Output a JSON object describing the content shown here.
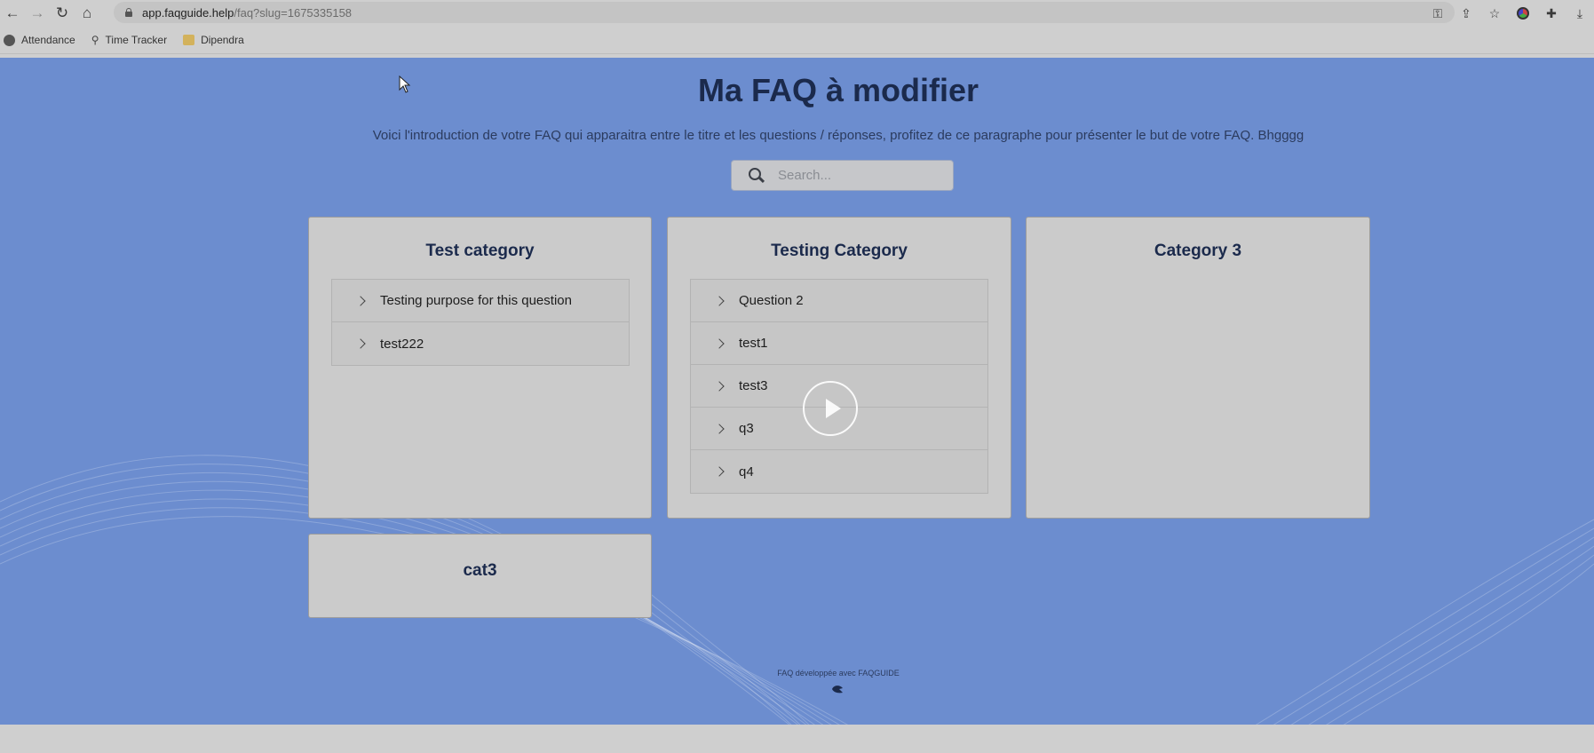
{
  "browser": {
    "url_host": "app.faqguide.help",
    "url_path": "/faq?slug=1675335158",
    "bookmarks": [
      "Attendance",
      "Time Tracker",
      "Dipendra"
    ]
  },
  "page": {
    "title": "Ma FAQ à modifier",
    "intro": "Voici l'introduction de votre FAQ qui apparaitra entre le titre et les questions / réponses, profitez de ce paragraphe pour présenter le but de votre FAQ. Bhgggg",
    "search_placeholder": "Search..."
  },
  "categories": [
    {
      "title": "Test category",
      "questions": [
        "Testing purpose for this question",
        "test222"
      ]
    },
    {
      "title": "Testing Category",
      "questions": [
        "Question 2",
        "test1",
        "test3",
        "q3",
        "q4"
      ]
    },
    {
      "title": "Category 3",
      "questions": []
    },
    {
      "title": "cat3",
      "questions": []
    }
  ],
  "footer": {
    "text": "FAQ développée avec FAQGUIDE"
  },
  "colors": {
    "page_background": "#6c8dcf",
    "card_background": "#cbcbcb",
    "heading": "#1b2a4c"
  }
}
